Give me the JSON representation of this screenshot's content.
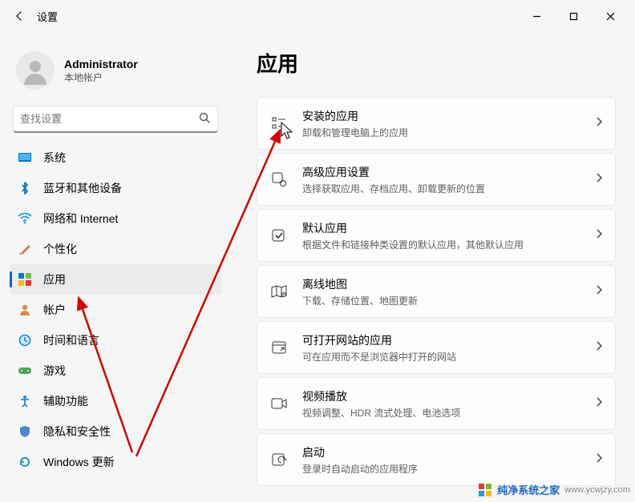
{
  "window": {
    "title": "设置"
  },
  "account": {
    "name": "Administrator",
    "type": "本地帐户"
  },
  "search": {
    "placeholder": "查找设置"
  },
  "nav": [
    {
      "label": "系统",
      "icon": "system"
    },
    {
      "label": "蓝牙和其他设备",
      "icon": "bluetooth"
    },
    {
      "label": "网络和 Internet",
      "icon": "wifi"
    },
    {
      "label": "个性化",
      "icon": "brush"
    },
    {
      "label": "应用",
      "icon": "apps",
      "selected": true
    },
    {
      "label": "帐户",
      "icon": "user"
    },
    {
      "label": "时间和语言",
      "icon": "clock"
    },
    {
      "label": "游戏",
      "icon": "gaming"
    },
    {
      "label": "辅助功能",
      "icon": "access"
    },
    {
      "label": "隐私和安全性",
      "icon": "privacy"
    },
    {
      "label": "Windows 更新",
      "icon": "update"
    }
  ],
  "page": {
    "heading": "应用",
    "items": [
      {
        "title": "安装的应用",
        "sub": "卸载和管理电脑上的应用",
        "icon": "installed"
      },
      {
        "title": "高级应用设置",
        "sub": "选择获取应用、存档应用、卸载更新的位置",
        "icon": "advanced"
      },
      {
        "title": "默认应用",
        "sub": "根据文件和链接种类设置的默认应用，其他默认应用",
        "icon": "default"
      },
      {
        "title": "离线地图",
        "sub": "下载、存储位置、地图更新",
        "icon": "maps"
      },
      {
        "title": "可打开网站的应用",
        "sub": "可在应用而不是浏览器中打开的网站",
        "icon": "websites"
      },
      {
        "title": "视频播放",
        "sub": "视频调整、HDR 流式处理、电池选项",
        "icon": "video"
      },
      {
        "title": "启动",
        "sub": "登录时自动启动的应用程序",
        "icon": "startup"
      }
    ]
  },
  "watermark": {
    "brand": "纯净系统之家",
    "url": "www.ycwjzy.com"
  }
}
